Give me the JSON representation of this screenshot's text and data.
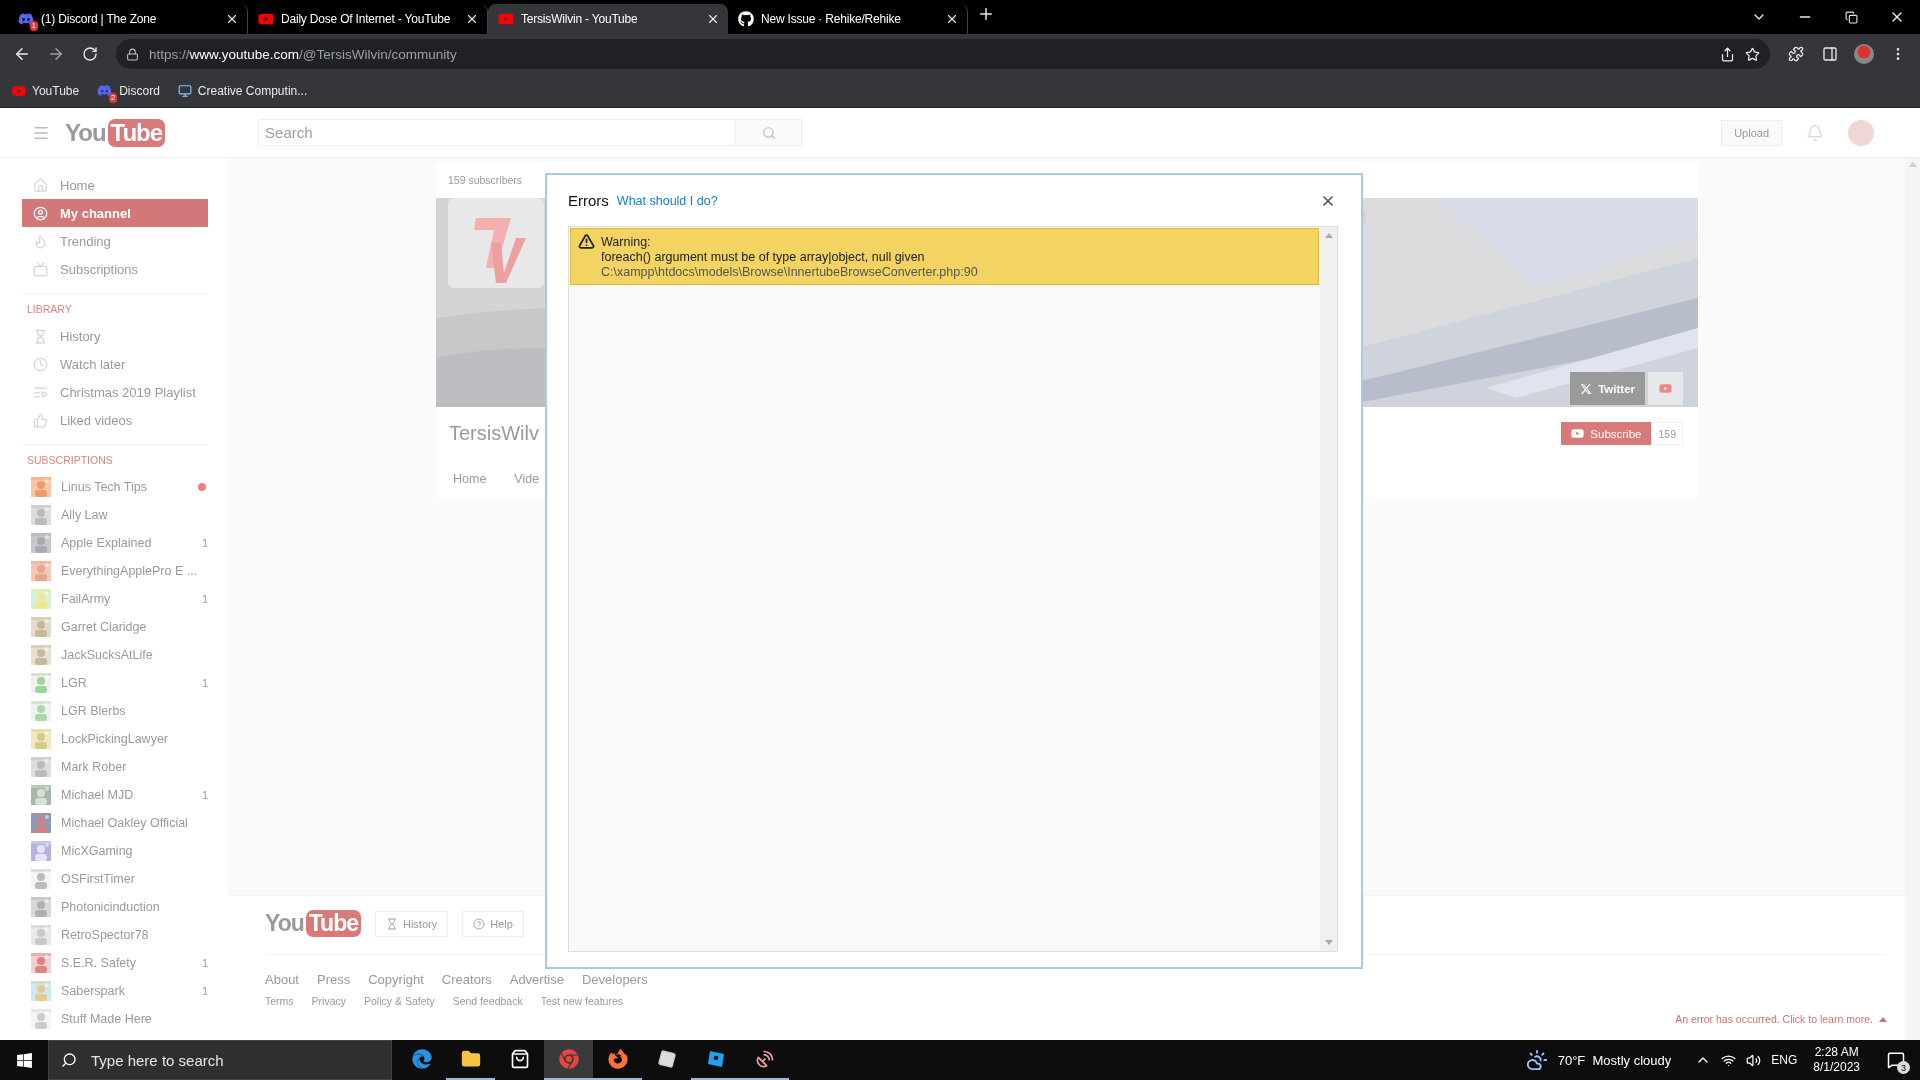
{
  "browser": {
    "tabs": [
      {
        "title": "(1) Discord | The Zone",
        "badge": "1",
        "selected": false
      },
      {
        "title": "Daily Dose Of Internet - YouTube",
        "selected": false
      },
      {
        "title": "TersisWilvin - YouTube",
        "selected": true
      },
      {
        "title": "New Issue · Rehike/Rehike",
        "selected": false
      }
    ],
    "address": {
      "scheme": "https://",
      "host": "www.youtube.com",
      "path": "/@TersisWilvin/community"
    },
    "bookmarks": [
      {
        "label": "YouTube"
      },
      {
        "label": "Discord",
        "badge": "2"
      },
      {
        "label": "Creative Computin..."
      }
    ]
  },
  "masthead": {
    "logo": {
      "left": "You",
      "right": "Tube"
    },
    "search_placeholder": "Search",
    "upload": "Upload"
  },
  "sidebar": {
    "nav": [
      {
        "label": "Home",
        "selected": false
      },
      {
        "label": "My channel",
        "selected": true
      },
      {
        "label": "Trending",
        "selected": false
      },
      {
        "label": "Subscriptions",
        "selected": false
      }
    ],
    "library": {
      "heading": "LIBRARY",
      "items": [
        "History",
        "Watch later",
        "Christmas 2019 Playlist",
        "Liked videos"
      ]
    },
    "subscriptions_heading": "SUBSCRIPTIONS",
    "subscriptions": [
      {
        "name": "Linus Tech Tips",
        "dot": true
      },
      {
        "name": "Ally Law",
        "dot": false
      },
      {
        "name": "Apple Explained",
        "count": "1",
        "dot": false
      },
      {
        "name": "EverythingApplePro E ...",
        "dot": false
      },
      {
        "name": "FailArmy",
        "count": "1",
        "dot": false
      },
      {
        "name": "Garret Claridge",
        "dot": false
      },
      {
        "name": "JackSucksAtLife",
        "dot": false
      },
      {
        "name": "LGR",
        "count": "1",
        "dot": false
      },
      {
        "name": "LGR Blerbs",
        "dot": false
      },
      {
        "name": "LockPickingLawyer",
        "dot": false
      },
      {
        "name": "Mark Rober",
        "dot": false
      },
      {
        "name": "Michael MJD",
        "count": "1",
        "dot": false
      },
      {
        "name": "Michael Oakley Official",
        "dot": false
      },
      {
        "name": "MicXGaming",
        "dot": false
      },
      {
        "name": "OSFirstTimer",
        "dot": false
      },
      {
        "name": "Photonicinduction",
        "dot": false
      },
      {
        "name": "RetroSpector78",
        "dot": false
      },
      {
        "name": "S.E.R. Safety",
        "count": "1",
        "dot": false
      },
      {
        "name": "Saberspark",
        "count": "1",
        "dot": false
      },
      {
        "name": "Stuff Made Here",
        "dot": false
      }
    ]
  },
  "channel": {
    "subscribers": "159 subscribers",
    "banner": {
      "kind": "picture"
    },
    "name": "TersisWilv",
    "tabs": [
      "Home",
      "Vide"
    ],
    "twitter": "Twitter",
    "subscribe": "Subscribe",
    "subscriber_count": "159"
  },
  "dialog": {
    "title": "Errors",
    "help_link": "What should I do?",
    "errors": [
      {
        "kind": "warning",
        "label": "Warning:",
        "message": "foreach() argument must be of type array|object, null given",
        "location": "C:\\xampp\\htdocs\\models\\Browse\\InnertubeBrowseConverter.php:90"
      }
    ]
  },
  "footer": {
    "logo": {
      "left": "You",
      "right": "Tube"
    },
    "buttons": [
      "History",
      "Help"
    ],
    "links": [
      "About",
      "Press",
      "Copyright",
      "Creators",
      "Advertise",
      "Developers"
    ],
    "sublinks": [
      "Terms",
      "Privacy",
      "Policy & Safety",
      "Send feedback",
      "Test new features"
    ],
    "error_notice": "An error has occurred. Click to learn more."
  },
  "taskbar": {
    "search_placeholder": "Type here to search",
    "apps": [
      {
        "selected": false,
        "running": false
      },
      {
        "selected": false,
        "running": true
      },
      {
        "selected": false,
        "running": false
      },
      {
        "selected": true,
        "running": true
      },
      {
        "selected": false,
        "running": true
      },
      {
        "selected": false,
        "running": false
      },
      {
        "selected": false,
        "running": true
      },
      {
        "selected": false,
        "running": true
      }
    ],
    "weather": {
      "temp": "70°F",
      "condition": "Mostly cloudy"
    },
    "language": "ENG",
    "time": "2:28 AM",
    "date": "8/1/2023",
    "notifications": "3"
  }
}
